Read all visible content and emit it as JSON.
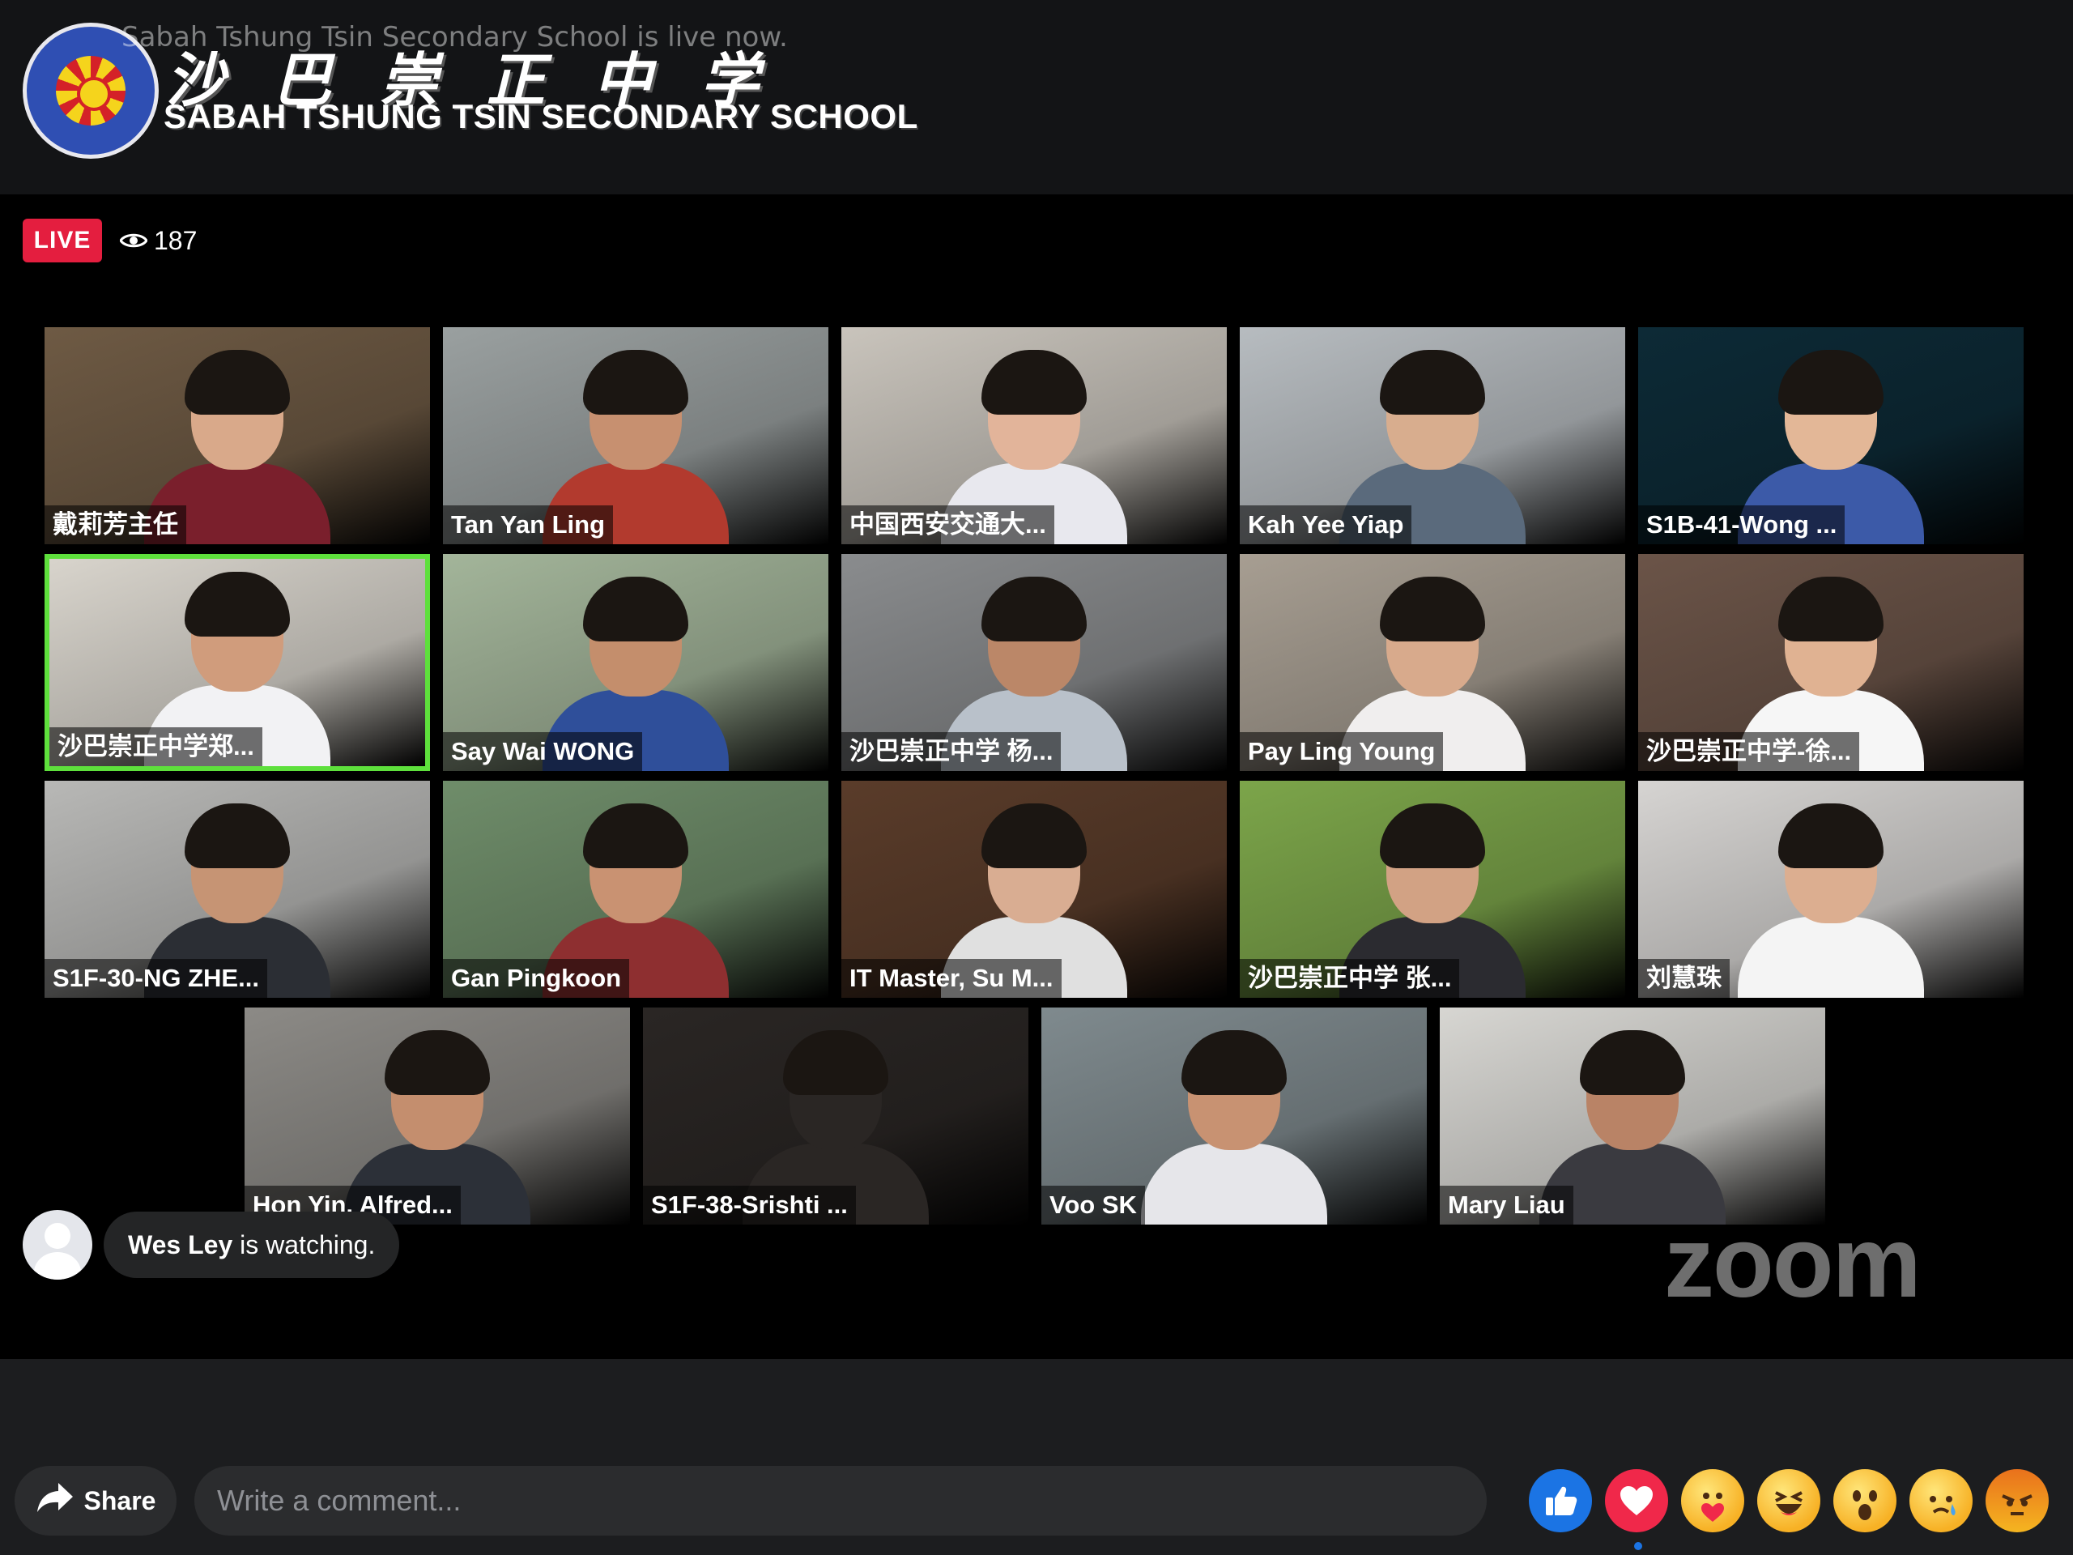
{
  "banner": {
    "live_notice": "Sabah Tshung Tsin Secondary School is live now.",
    "school_name_cn": "沙巴崇正中学",
    "school_name_en": "SABAH TSHUNG TSIN SECONDARY SCHOOL",
    "logo_icon": "school-crest-logo"
  },
  "stream": {
    "live_label": "LIVE",
    "viewer_count": "187",
    "viewer_icon": "eye-icon"
  },
  "zoom": {
    "watermark": "zoom",
    "participants": [
      {
        "name": "戴莉芳主任",
        "bg": "#6e5a44",
        "skin": "#d9a98a",
        "shirt": "#7a1f2c",
        "active": false
      },
      {
        "name": "Tan Yan Ling",
        "bg": "#9aa0a0",
        "skin": "#c79070",
        "shirt": "#b23a2e",
        "active": false
      },
      {
        "name": "中国西安交通大...",
        "bg": "#c9c4bc",
        "skin": "#e2b49a",
        "shirt": "#e8e8ee",
        "active": false
      },
      {
        "name": "Kah Yee Yiap",
        "bg": "#b7bcc0",
        "skin": "#d8ad8e",
        "shirt": "#5a6a7c",
        "active": false
      },
      {
        "name": "S1B-41-Wong ...",
        "bg": "#0d2a36",
        "skin": "#e3b797",
        "shirt": "#3c5aa8",
        "active": false
      },
      {
        "name": "沙巴崇正中学郑...",
        "bg": "#d8d4cc",
        "skin": "#d09c7c",
        "shirt": "#f2f2f4",
        "active": true
      },
      {
        "name": "Say Wai WONG",
        "bg": "#a3b59a",
        "skin": "#c48e6c",
        "shirt": "#2f4f9a",
        "active": false
      },
      {
        "name": "沙巴崇正中学 杨...",
        "bg": "#8a8c8e",
        "skin": "#bb8768",
        "shirt": "#b9c1ca",
        "active": false
      },
      {
        "name": "Pay Ling Young",
        "bg": "#a79e92",
        "skin": "#d8aa8c",
        "shirt": "#f0eeee",
        "active": false
      },
      {
        "name": "沙巴崇正中学-徐...",
        "bg": "#6b5448",
        "skin": "#e0b292",
        "shirt": "#f6f6f6",
        "active": false
      },
      {
        "name": "S1F-30-NG ZHE...",
        "bg": "#b8b8b6",
        "skin": "#c69474",
        "shirt": "#2b2e34",
        "active": false
      },
      {
        "name": "Gan Pingkoon",
        "bg": "#6f8d6a",
        "skin": "#c99272",
        "shirt": "#8e2f30",
        "active": false
      },
      {
        "name": "IT Master, Su M...",
        "bg": "#5a3c2a",
        "skin": "#d9ad92",
        "shirt": "#e0e0e0",
        "active": false
      },
      {
        "name": "沙巴崇正中学 张...",
        "bg": "#7ca54a",
        "skin": "#d2a284",
        "shirt": "#2b2b30",
        "active": false
      },
      {
        "name": "刘慧珠",
        "bg": "#d6d4d2",
        "skin": "#dcae90",
        "shirt": "#f4f4f4",
        "active": false
      },
      {
        "name": "Hon Yin, Alfred...",
        "bg": "#8c8a86",
        "skin": "#c48e6e",
        "shirt": "#2c3038",
        "active": false
      },
      {
        "name": "S1F-38-Srishti ...",
        "bg": "#2a2624",
        "skin": "#2a2624",
        "shirt": "#2a2624",
        "active": false
      },
      {
        "name": "Voo SK",
        "bg": "#7f8a8e",
        "skin": "#c89272",
        "shirt": "#e6e6ea",
        "active": false
      },
      {
        "name": "Mary Liau",
        "bg": "#d7d6d2",
        "skin": "#b98366",
        "shirt": "#3a3a40",
        "active": false
      }
    ]
  },
  "watching": {
    "user": "Wes Ley",
    "text": " is watching.",
    "avatar_icon": "default-avatar-icon"
  },
  "footer": {
    "share_label": "Share",
    "share_icon": "share-arrow-icon",
    "comment_placeholder": "Write a comment...",
    "reactions": [
      "like",
      "love",
      "care",
      "haha",
      "wow",
      "sad",
      "angry"
    ]
  }
}
